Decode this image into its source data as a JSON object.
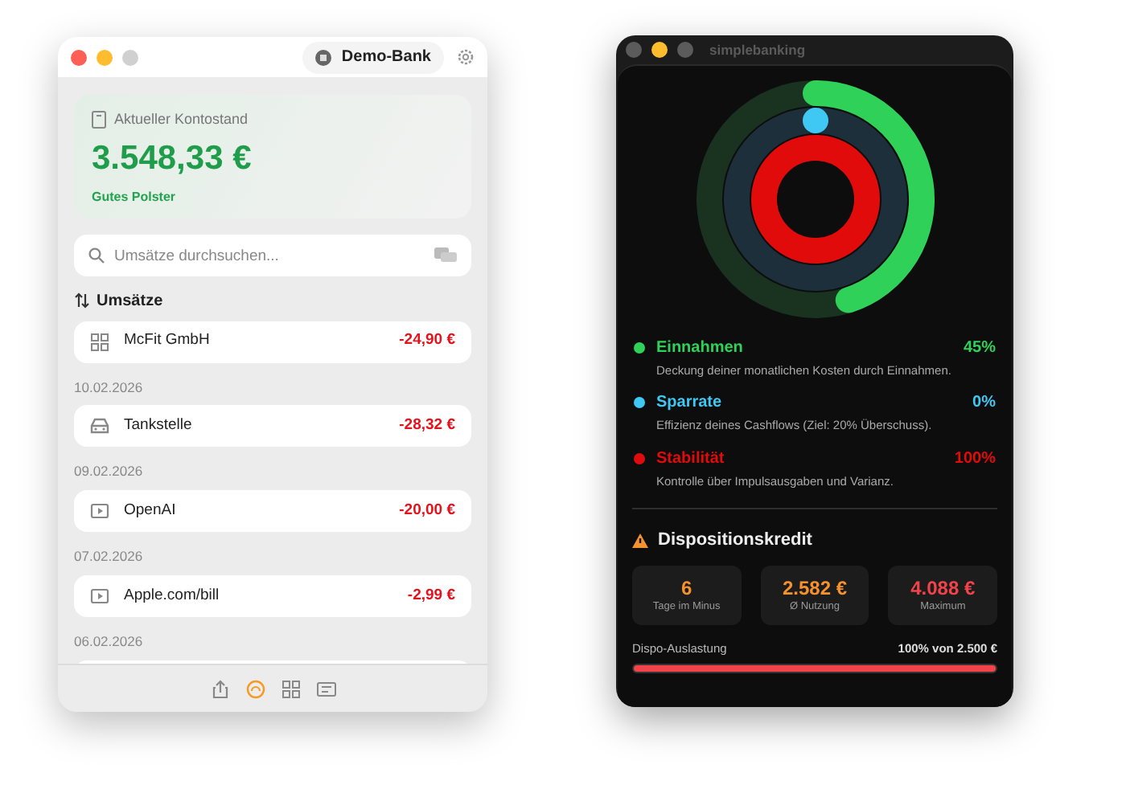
{
  "left_window": {
    "account_button": "Demo-Bank",
    "balance_card": {
      "label": "Aktueller Kontostand",
      "amount": "3.548,33 €",
      "status": "Gutes Polster"
    },
    "search": {
      "placeholder": "Umsätze durchsuchen..."
    },
    "section_title": "Umsätze",
    "transactions": [
      {
        "kind": "grid",
        "name": "McFit GmbH",
        "amount": "-24,90 €"
      },
      {
        "date": "10.02.2026",
        "kind": "car",
        "name": "Tankstelle",
        "amount": "-28,32 €"
      },
      {
        "date": "09.02.2026",
        "kind": "play",
        "name": "OpenAI",
        "amount": "-20,00 €"
      },
      {
        "date": "07.02.2026",
        "kind": "play",
        "name": "Apple.com/bill",
        "amount": "-2,99 €"
      },
      {
        "date": "06.02.2026",
        "kind": "cut"
      }
    ],
    "toolbar": [
      {
        "kind": "share",
        "selected": false
      },
      {
        "kind": "gauge",
        "selected": true
      },
      {
        "kind": "grid",
        "selected": false
      },
      {
        "kind": "list",
        "selected": false
      }
    ]
  },
  "right_window": {
    "title": "simplebanking",
    "metrics": [
      {
        "name": "Einnahmen",
        "value": "45%",
        "description": "Deckung deiner monatlichen Kosten durch Einnahmen.",
        "color": "#30d158",
        "level": 0.45
      },
      {
        "name": "Sparrate",
        "value": "0%",
        "description": "Effizienz deines Cashflows (Ziel: 20% Überschuss).",
        "color": "#40c8f4",
        "level": 0
      },
      {
        "name": "Stabilität",
        "value": "100%",
        "description": "Kontrolle über Impulsausgaben und Varianz.",
        "color": "#e10b0b",
        "level": 1
      }
    ],
    "overdraft": {
      "title": "Dispositionskredit",
      "stats": [
        {
          "value": "6",
          "label": "Tage im Minus",
          "color": "#f5922e"
        },
        {
          "value": "2.582 €",
          "label": "Ø Nutzung",
          "color": "#f5922e"
        },
        {
          "value": "4.088 €",
          "label": "Maximum",
          "color": "#f0444a"
        }
      ],
      "usage_label": "Dispo-Auslastung",
      "usage_value": "100% von 2.500 €",
      "level": 1
    }
  }
}
